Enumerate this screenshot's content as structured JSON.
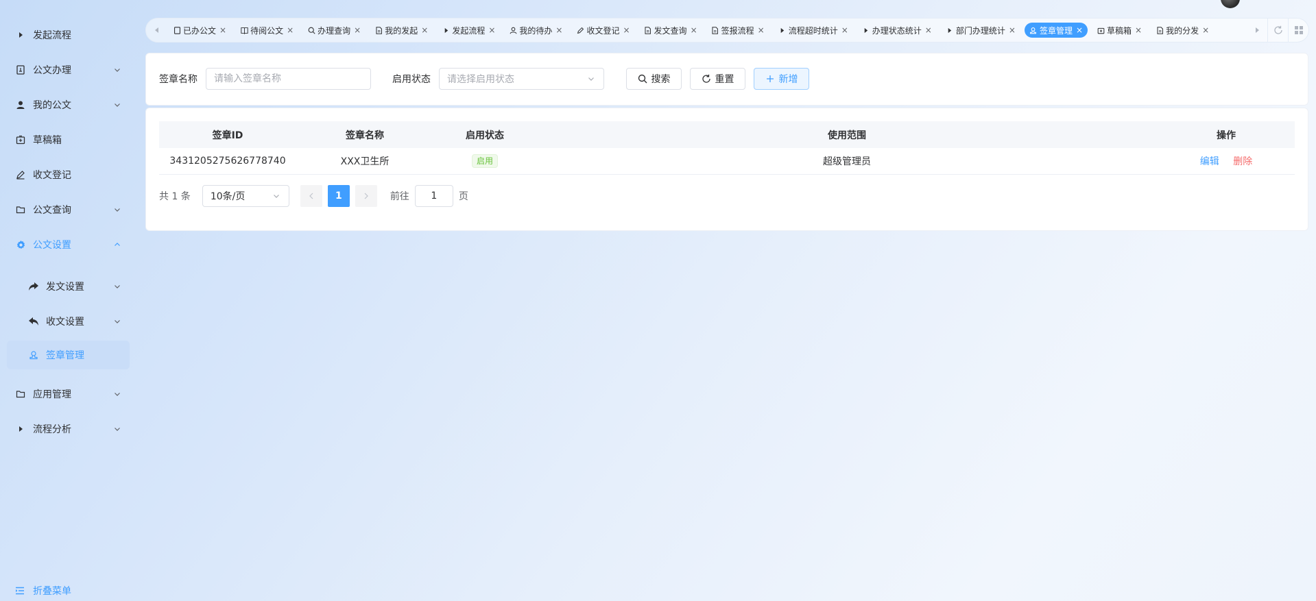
{
  "sidebar": {
    "items": [
      {
        "label": "发起流程",
        "icon": "caret-right-icon"
      },
      {
        "label": "公文办理",
        "icon": "document-icon"
      },
      {
        "label": "我的公文",
        "icon": "user-icon"
      },
      {
        "label": "草稿箱",
        "icon": "draft-box-icon"
      },
      {
        "label": "收文登记",
        "icon": "pen-icon"
      },
      {
        "label": "公文查询",
        "icon": "folder-icon"
      },
      {
        "label": "公文设置",
        "icon": "gear-icon"
      },
      {
        "label": "发文设置",
        "icon": "share-forward-icon"
      },
      {
        "label": "收文设置",
        "icon": "reply-icon"
      },
      {
        "label": "签章管理",
        "icon": "seal-icon"
      },
      {
        "label": "应用管理",
        "icon": "folder-icon"
      },
      {
        "label": "流程分析",
        "icon": "caret-right-icon"
      }
    ],
    "collapse_label": "折叠菜单"
  },
  "tabs": [
    {
      "label": "已办公文",
      "icon": "document-icon"
    },
    {
      "label": "待阅公文",
      "icon": "book-icon"
    },
    {
      "label": "办理查询",
      "icon": "search-icon"
    },
    {
      "label": "我的发起",
      "icon": "file-icon"
    },
    {
      "label": "发起流程",
      "icon": "caret-right-icon"
    },
    {
      "label": "我的待办",
      "icon": "user-icon"
    },
    {
      "label": "收文登记",
      "icon": "pen-icon"
    },
    {
      "label": "发文查询",
      "icon": "file-icon"
    },
    {
      "label": "签报流程",
      "icon": "file-icon"
    },
    {
      "label": "流程超时统计",
      "icon": "caret-right-icon"
    },
    {
      "label": "办理状态统计",
      "icon": "caret-right-icon"
    },
    {
      "label": "部门办理统计",
      "icon": "caret-right-icon"
    },
    {
      "label": "签章管理",
      "icon": "seal-icon",
      "active": true
    },
    {
      "label": "草稿箱",
      "icon": "draft-box-icon"
    },
    {
      "label": "我的分发",
      "icon": "file-icon"
    }
  ],
  "search": {
    "name_label": "签章名称",
    "name_placeholder": "请输入签章名称",
    "status_label": "启用状态",
    "status_placeholder": "请选择启用状态",
    "search_label": "搜索",
    "reset_label": "重置",
    "add_label": "新增"
  },
  "table": {
    "columns": [
      "签章ID",
      "签章名称",
      "启用状态",
      "使用范围",
      "操作"
    ],
    "rows": [
      {
        "id": "3431205275626778740",
        "name": "XXX卫生所",
        "status": "启用",
        "scope": "超级管理员",
        "edit": "编辑",
        "delete": "删除"
      }
    ]
  },
  "pagination": {
    "total": "共 1 条",
    "page_size": "10条/页",
    "current_page": "1",
    "jump_prefix": "前往",
    "jump_value": "1",
    "jump_suffix": "页"
  },
  "colors": {
    "primary": "#409eff",
    "danger": "#f56c6c",
    "success": "#67c23a"
  }
}
